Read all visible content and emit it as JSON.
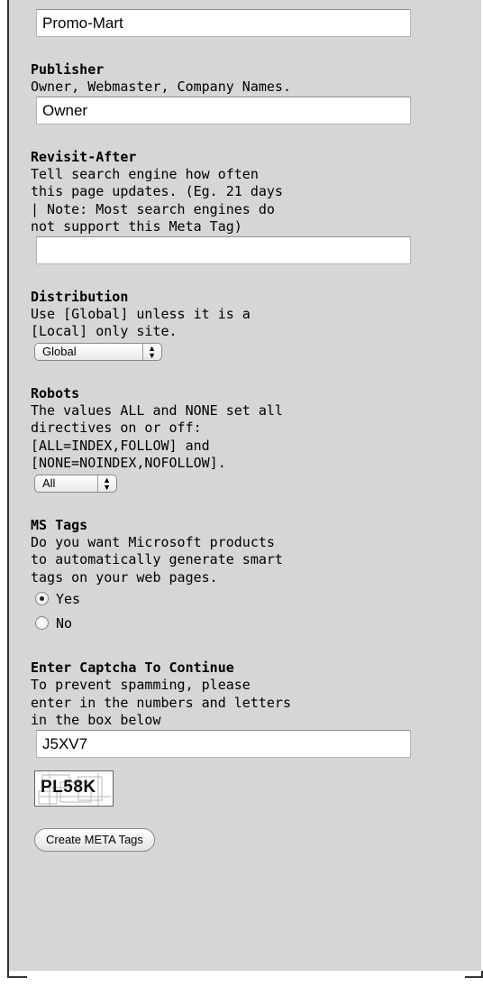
{
  "fields": {
    "company_value": "Promo-Mart",
    "publisher": {
      "label": "Publisher",
      "desc": "Owner, Webmaster, Company Names.",
      "value": "Owner"
    },
    "revisit": {
      "label": "Revisit-After",
      "desc": "Tell search engine how often\nthis page updates. (Eg. 21 days\n| Note: Most search engines do\nnot support this Meta Tag)",
      "value": ""
    },
    "distribution": {
      "label": "Distribution",
      "desc": "Use [Global] unless it is a\n[Local] only site.",
      "selected": "Global"
    },
    "robots": {
      "label": "Robots",
      "desc": "The values ALL and NONE set all\ndirectives on or off:\n[ALL=INDEX,FOLLOW] and\n[NONE=NOINDEX,NOFOLLOW].",
      "selected": "All"
    },
    "mstags": {
      "label": "MS Tags",
      "desc": "Do you want Microsoft products\nto automatically generate smart\ntags on your web pages.",
      "options": [
        "Yes",
        "No"
      ],
      "selected": "Yes"
    },
    "captcha": {
      "label": "Enter Captcha To Continue",
      "desc": "To prevent spamming, please\nenter in the numbers and letters\nin the box below",
      "value": "J5XV7",
      "image_text": "PL58K"
    }
  },
  "actions": {
    "submit_label": "Create META Tags"
  },
  "icons": {
    "select_arrows": "up-down-arrows-icon",
    "radio": "radio-icon"
  }
}
